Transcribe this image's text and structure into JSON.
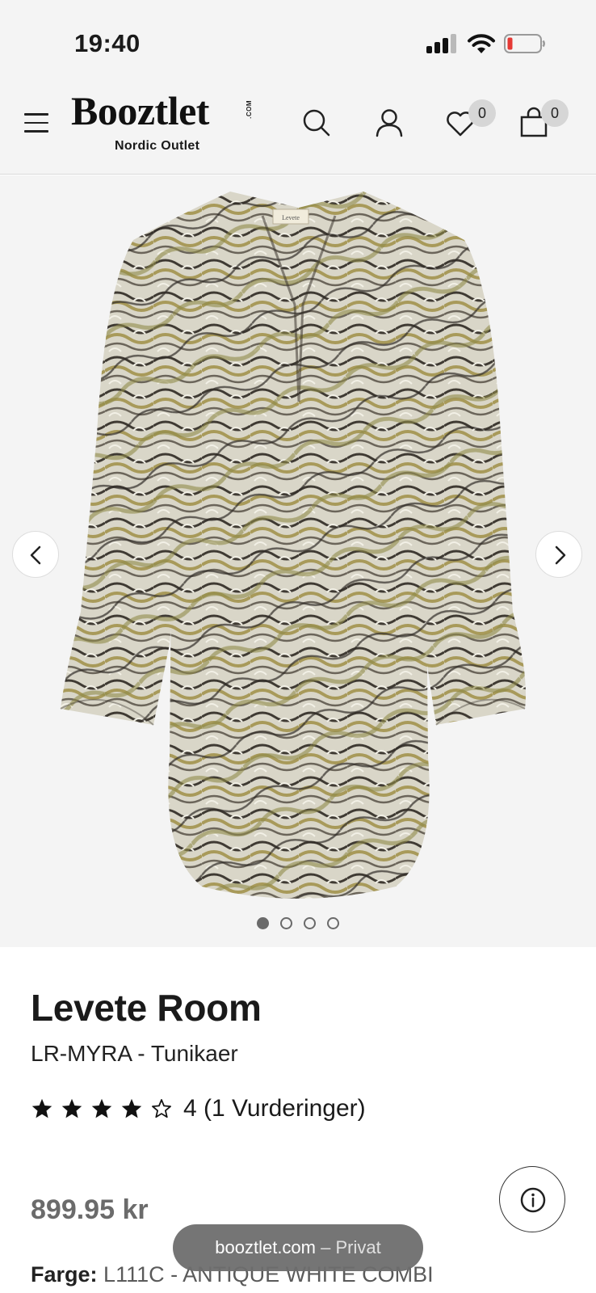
{
  "status_bar": {
    "time": "19:40"
  },
  "header": {
    "logo_text": "Booztlet",
    "logo_com": ".COM",
    "logo_subtitle": "Nordic Outlet",
    "wishlist_count": "0",
    "cart_count": "0"
  },
  "gallery": {
    "image_alt": "LR-MYRA tunic, marble print",
    "label_text": "Levete",
    "current_slide": 1,
    "slide_count": 4
  },
  "product": {
    "brand": "Levete Room",
    "name": "LR-MYRA - Tunikaer",
    "rating_value": 4,
    "rating_max": 5,
    "rating_text": "4 (1 Vurderinger)",
    "price": "899.95 kr",
    "color_label": "Farge:",
    "color_value": "L111C - ANTIQUE WHITE COMBI"
  },
  "browser": {
    "domain": "booztlet.com",
    "mode": "– Privat"
  },
  "colors": {
    "background": "#f4f4f4",
    "text": "#1a1a1a",
    "price": "#6b6b6b",
    "badge": "#d6d6d6",
    "battery_low": "#e53935"
  }
}
